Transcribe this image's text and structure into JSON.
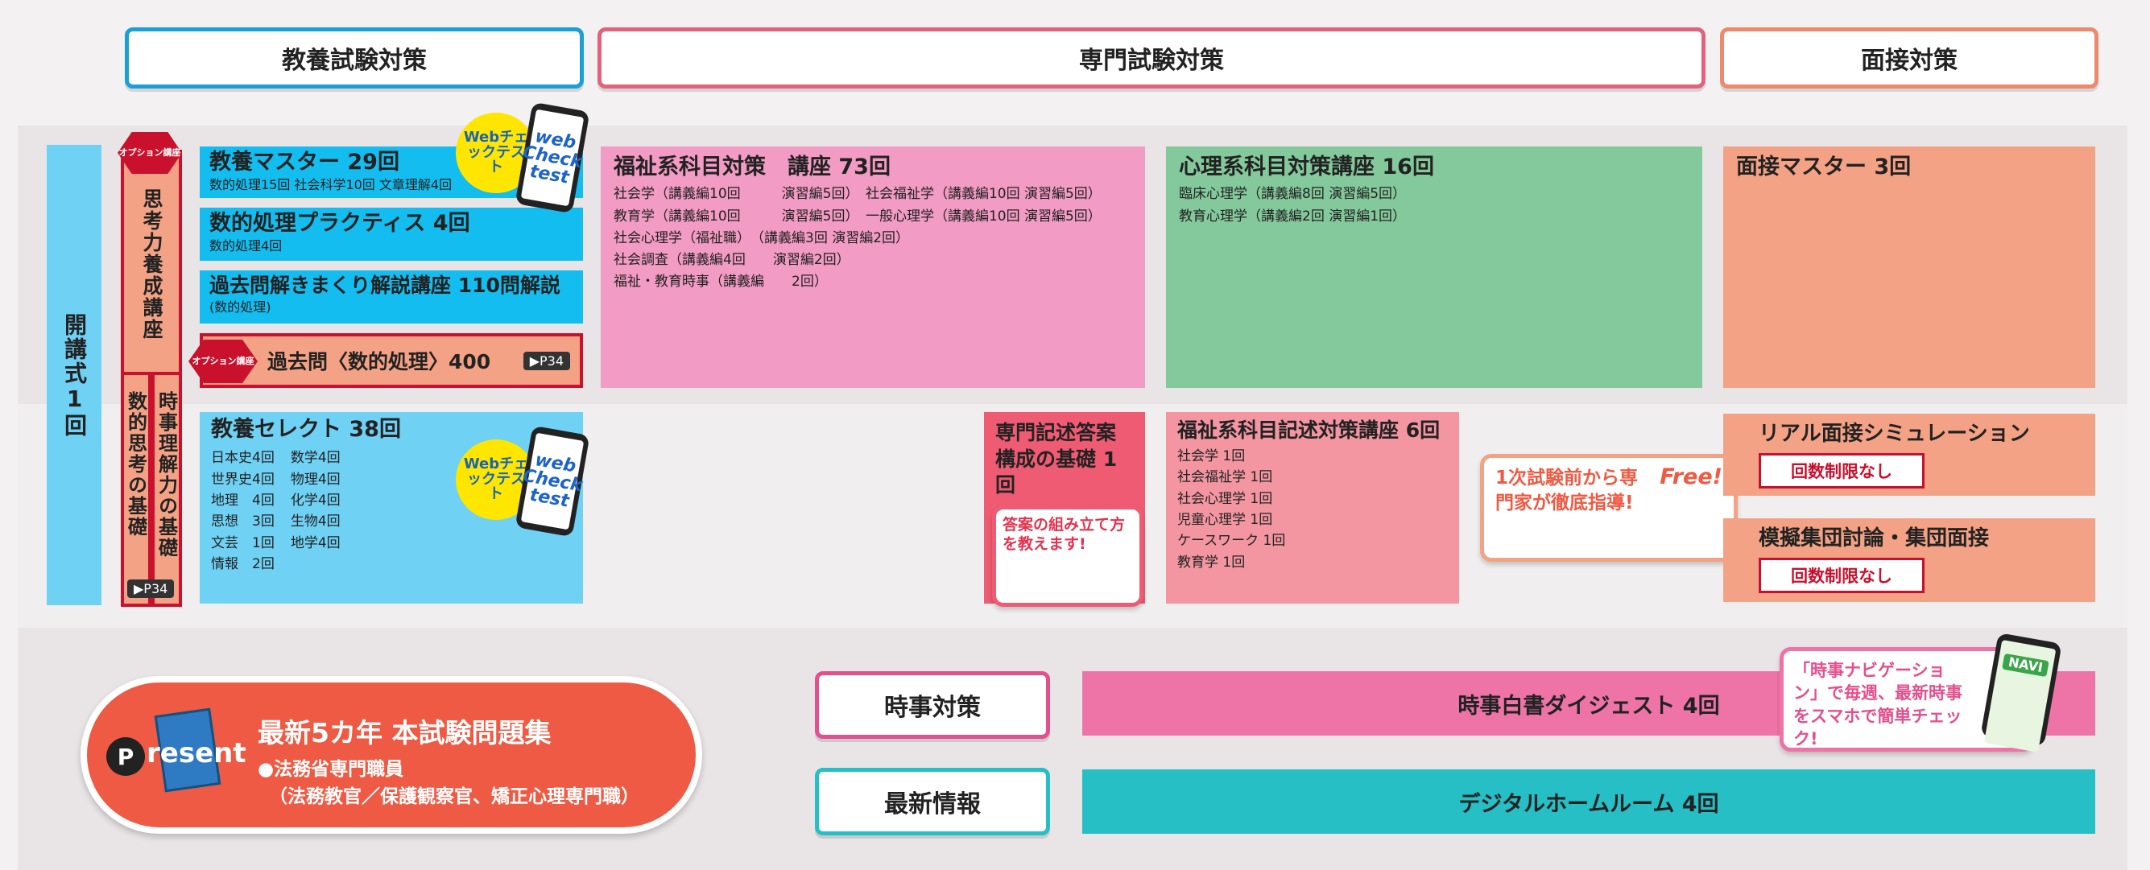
{
  "headers": {
    "general": "教養試験対策",
    "specialized": "専門試験対策",
    "interview": "面接対策"
  },
  "colors": {
    "blue_header": "#1a9fd6",
    "pink_header": "#e2627c",
    "orange_header": "#ee8a6c",
    "cyan_box": "#14bdf0",
    "light_blue_box": "#6fd1f4",
    "pink_box": "#f29bc4",
    "green_box": "#84c99c",
    "salmon_box": "#f4a285",
    "red_box": "#ee5b72",
    "rose_box": "#f396a2",
    "orange_pill": "#ee5a43",
    "teal_bar": "#26bfc6",
    "magenta_bar": "#ee74a8"
  },
  "opening": {
    "label": "開講式",
    "count": "1回"
  },
  "option_badge": "オプション講座",
  "thinking_course": "思考力養成講座",
  "numeric_basics": "数的思考の基礎",
  "current_affairs_basics": "時事理解力の基礎",
  "page_ref": "▶P34",
  "courses": {
    "kyoyo_master": {
      "title": "教養マスター 29回",
      "detail": "数的処理15回 社会科学10回 文章理解4回"
    },
    "numeric_practice": {
      "title": "数的処理プラクティス 4回",
      "detail": "数的処理4回"
    },
    "past_exam": {
      "title": "過去問解きまくり解説講座 110問解説",
      "detail": "(数的処理)"
    },
    "past_numeric": {
      "title": "過去問〈数的処理〉400",
      "ref": "▶P34"
    },
    "kyoyo_select": {
      "title": "教養セレクト 38回",
      "left": [
        "日本史4回",
        "世界史4回",
        "地理　4回",
        "思想　3回",
        "文芸　1回",
        "情報　2回"
      ],
      "right": [
        "数学4回",
        "物理4回",
        "化学4回",
        "生物4回",
        "地学4回"
      ]
    },
    "welfare": {
      "title": "福祉系科目対策　講座 73回",
      "lines": [
        "社会学（講義編10回　　　演習編5回）　社会福祉学（講義編10回 演習編5回）",
        "教育学（講義編10回　　　演習編5回）　一般心理学（講義編10回 演習編5回）",
        "社会心理学（福祉職）　（講義編3回 演習編2回）",
        "社会調査（講義編4回　　演習編2回）",
        "福祉・教育時事（講義編　　2回）"
      ]
    },
    "psychology": {
      "title": "心理系科目対策講座 16回",
      "lines": [
        "臨床心理学（講義編8回 演習編5回）",
        "教育心理学（講義編2回 演習編1回）"
      ]
    },
    "interview_master": {
      "title": "面接マスター 3回"
    },
    "essay_basics": {
      "title": "専門記述答案構成の基礎 1回",
      "callout": "答案の組み立て方を教えます!"
    },
    "welfare_essay": {
      "title": "福祉系科目記述対策講座 6回",
      "lines": [
        "社会学 1回",
        "社会福祉学 1回",
        "社会心理学 1回",
        "児童心理学 1回",
        "ケースワーク 1回",
        "教育学 1回"
      ]
    },
    "real_interview": {
      "title": "リアル面接シミュレーション",
      "limit": "回数制限なし"
    },
    "group_interview": {
      "title": "模擬集団討論・集団面接",
      "limit": "回数制限なし"
    }
  },
  "web_check": {
    "circle": "Webチェックテスト",
    "phone": "web Check test"
  },
  "free_callout": {
    "text": "1次試験前から専門家が徹底指導!",
    "free": "Free!"
  },
  "present": {
    "badge_letter": "P",
    "badge_rest": "resent",
    "title": "最新5カ年 本試験問題集",
    "line1": "●法務省専門職員",
    "line2": "（法務教官／保護観察官、矯正心理専門職）"
  },
  "current_affairs": {
    "label": "時事対策",
    "bar": "時事白書ダイジェスト 4回",
    "callout": "「時事ナビゲーション」で毎週、最新時事をスマホで簡単チェック!",
    "phone": "NAVI"
  },
  "latest_info": {
    "label": "最新情報",
    "bar": "デジタルホームルーム 4回"
  }
}
